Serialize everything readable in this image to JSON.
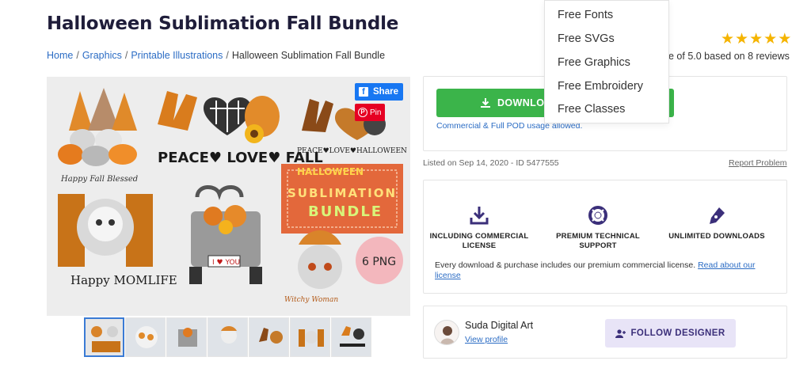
{
  "page": {
    "title": "Halloween Sublimation Fall Bundle"
  },
  "breadcrumb": {
    "items": [
      "Home",
      "Graphics",
      "Printable Illustrations"
    ],
    "current": "Halloween Sublimation Fall Bundle",
    "separator": "/"
  },
  "rating": {
    "stars": 5,
    "text": "e of 5.0 based on 8 reviews",
    "color": "#f5b400"
  },
  "dropdown": {
    "items": [
      "Free Fonts",
      "Free SVGs",
      "Free Graphics",
      "Free Embroidery",
      "Free Classes"
    ]
  },
  "image": {
    "share_label": "Share",
    "pin_label": "Pin",
    "artwork": {
      "gnome_caption": "Happy Fall Blessed",
      "peace_text": "PEACE♥ LOVE♥ FALL",
      "peace_halloween": "PEACE♥LOVE♥HALLOWEEN",
      "ticket_line1": "HALLOWEEN",
      "ticket_line2": "SUBLIMATION",
      "ticket_line3": "BUNDLE",
      "mom_text": "MOM",
      "momlife": "Happy MOMLIFE",
      "truck_plate": "I ♥ YOU",
      "png_badge": "6 PNG",
      "witchy": "Witchy Woman"
    },
    "thumbnail_count": 7
  },
  "download": {
    "button_label": "DOWNLOA",
    "license_note": "Commercial & Full POD usage allowed.",
    "accent": "#3bb44a"
  },
  "listing": {
    "listed_text": "Listed on Sep 14, 2020 - ID 5477555",
    "report_label": "Report Problem"
  },
  "features": {
    "items": [
      {
        "line1": "INCLUDING COMMERCIAL",
        "line2": "LICENSE",
        "icon": "download-tray-icon"
      },
      {
        "line1": "PREMIUM TECHNICAL",
        "line2": "SUPPORT",
        "icon": "lifebuoy-icon"
      },
      {
        "line1": "UNLIMITED DOWNLOADS",
        "line2": "",
        "icon": "pen-nib-icon"
      }
    ],
    "note_prefix": "Every download & purchase includes our premium commercial license.",
    "note_link": "Read about our license",
    "icon_color": "#3b2f7a"
  },
  "designer": {
    "name": "Suda Digital Art",
    "view_profile": "View profile",
    "follow_label": "FOLLOW DESIGNER"
  }
}
